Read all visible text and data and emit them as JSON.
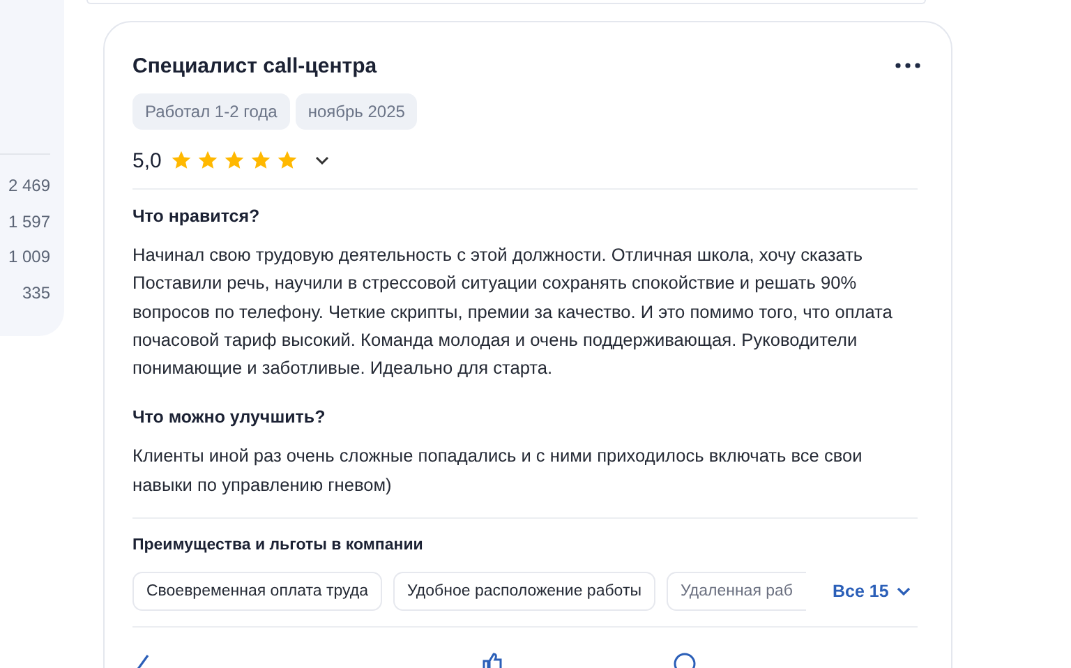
{
  "side_counts": [
    "2 469",
    "1 597",
    "1 009",
    "335"
  ],
  "review": {
    "title": "Специалист call-центра",
    "tags": [
      "Работал 1-2 года",
      "ноябрь 2025"
    ],
    "rating": "5,0",
    "stars": 5,
    "sections": [
      {
        "heading": "Что нравится?",
        "text": "Начинал свою трудовую деятельность с этой должности. Отличная школа, хочу сказать Поставили речь, научили в стрессовой ситуации сохранять спокойствие и решать 90% вопросов по телефону. Четкие скрипты, премии за качество. И это помимо того, что оплата почасовой тариф высокий. Команда молодая и очень поддерживающая. Руководители понимающие и заботливые. Идеально для старта."
      },
      {
        "heading": "Что можно улучшить?",
        "text": "Клиенты иной раз очень сложные попадались и с ними приходилось включать все свои навыки по управлению гневом)"
      }
    ],
    "benefits": {
      "heading": "Преимущества и льготы в компании",
      "items": [
        "Своевременная оплата труда",
        "Удобное расположение работы",
        "Удаленная раб"
      ],
      "more": "Все 15"
    }
  }
}
